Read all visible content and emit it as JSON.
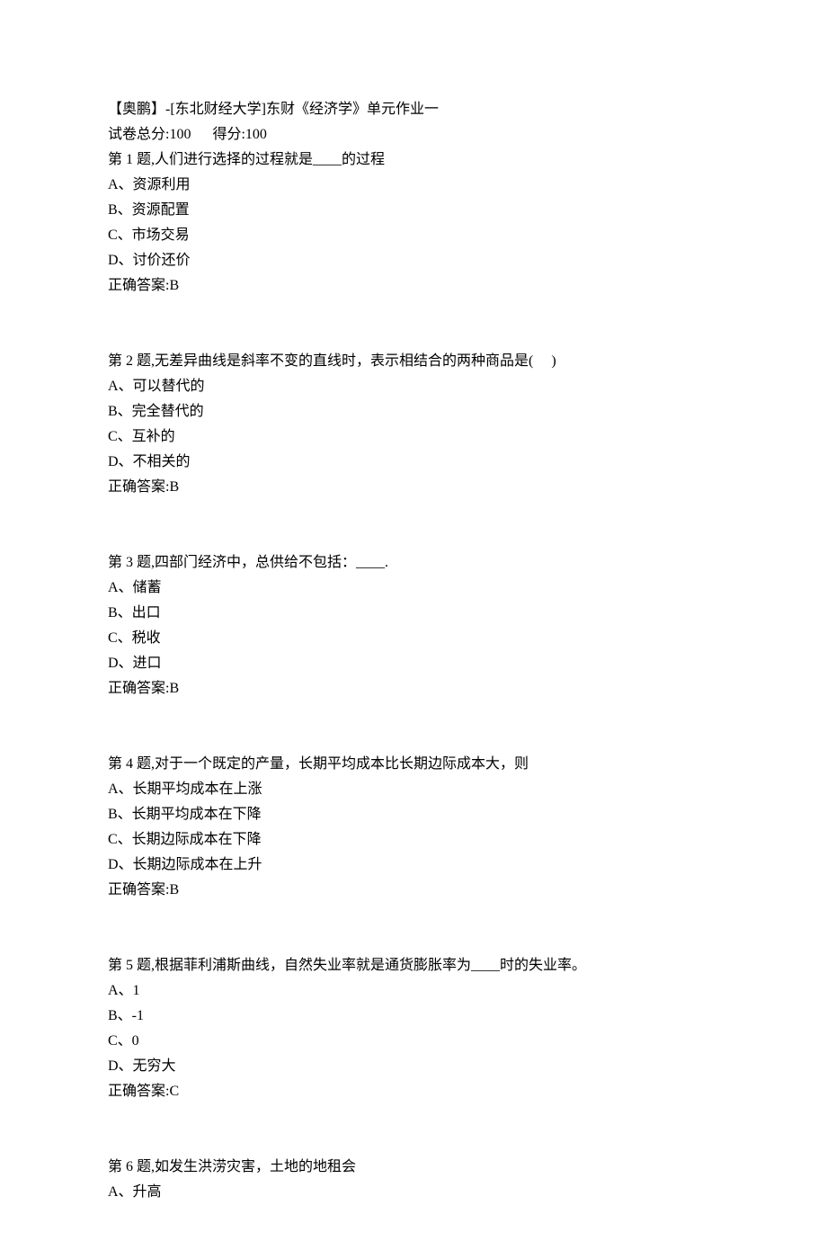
{
  "header": {
    "title": "【奥鹏】-[东北财经大学]东财《经济学》单元作业一",
    "score_line": "试卷总分:100      得分:100"
  },
  "questions": [
    {
      "prompt": "第 1 题,人们进行选择的过程就是____的过程",
      "options": [
        "A、资源利用",
        "B、资源配置",
        "C、市场交易",
        "D、讨价还价"
      ],
      "answer": "正确答案:B"
    },
    {
      "prompt": "第 2 题,无差异曲线是斜率不变的直线时，表示相结合的两种商品是(     )",
      "options": [
        "A、可以替代的",
        "B、完全替代的",
        "C、互补的",
        "D、不相关的"
      ],
      "answer": "正确答案:B"
    },
    {
      "prompt": "第 3 题,四部门经济中，总供给不包括：____.",
      "options": [
        "A、储蓄",
        "B、出口",
        "C、税收",
        "D、进口"
      ],
      "answer": "正确答案:B"
    },
    {
      "prompt": "第 4 题,对于一个既定的产量，长期平均成本比长期边际成本大，则",
      "options": [
        "A、长期平均成本在上涨",
        "B、长期平均成本在下降",
        "C、长期边际成本在下降",
        "D、长期边际成本在上升"
      ],
      "answer": "正确答案:B"
    },
    {
      "prompt": "第 5 题,根据菲利浦斯曲线，自然失业率就是通货膨胀率为____时的失业率。",
      "options": [
        "A、1",
        "B、-1",
        "C、0",
        "D、无穷大"
      ],
      "answer": "正确答案:C"
    },
    {
      "prompt": "第 6 题,如发生洪涝灾害，土地的地租会",
      "options": [
        "A、升高"
      ],
      "answer": null
    }
  ]
}
